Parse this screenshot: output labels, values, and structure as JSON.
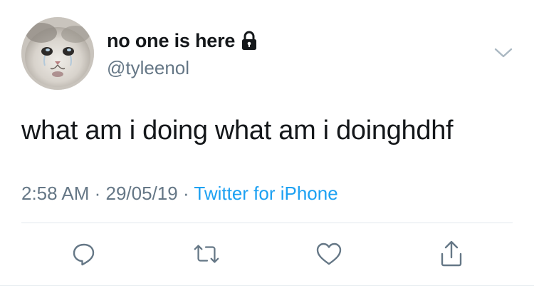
{
  "tweet": {
    "display_name": "no one is here",
    "handle": "@tyleenol",
    "text": "what am i doing what am i doinghdhf",
    "time": "2:58 AM",
    "separator": " · ",
    "date": "29/05/19",
    "source": "Twitter for iPhone"
  },
  "icons": {
    "avatar": "crying-cat-avatar",
    "lock": "lock-icon",
    "more": "chevron-down-icon",
    "reply": "reply-icon",
    "retweet": "retweet-icon",
    "like": "heart-icon",
    "share": "share-icon"
  },
  "colors": {
    "text": "#14171a",
    "secondary": "#657786",
    "link": "#1da1f2",
    "divider": "#e1e8ed"
  }
}
